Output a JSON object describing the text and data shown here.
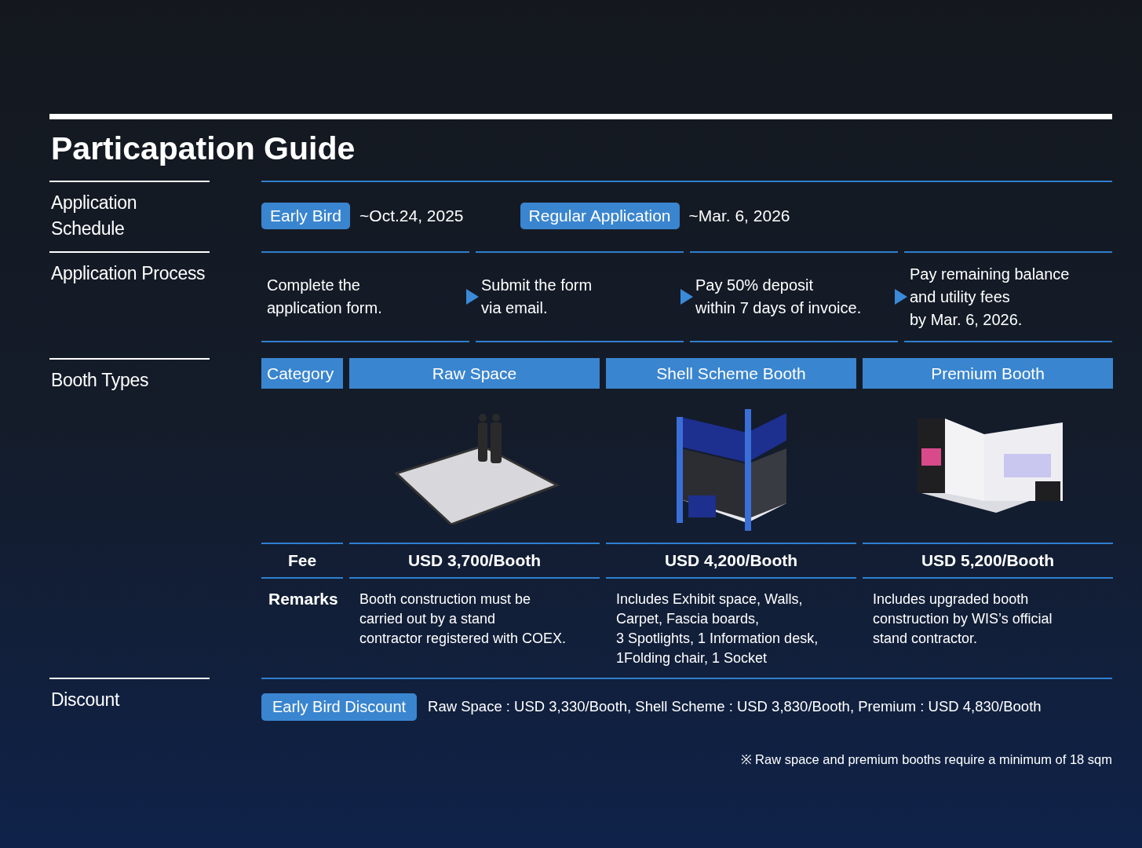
{
  "title": "Particapation Guide",
  "schedule": {
    "label": "Application Schedule",
    "items": [
      {
        "badge": "Early Bird",
        "date": "~Oct.24, 2025"
      },
      {
        "badge": "Regular Application",
        "date": "~Mar. 6, 2026"
      }
    ]
  },
  "process": {
    "label": "Application Process",
    "steps": [
      {
        "lines": [
          "Complete the",
          "application form."
        ]
      },
      {
        "lines": [
          "Submit the form",
          "via email."
        ]
      },
      {
        "lines": [
          "Pay 50% deposit",
          "within 7 days of invoice."
        ]
      },
      {
        "lines": [
          "Pay remaining balance",
          "and utility fees",
          "by Mar. 6, 2026."
        ]
      }
    ]
  },
  "booths": {
    "label": "Booth Types",
    "category": "Category",
    "types": [
      {
        "kind": "raw",
        "name": "Raw Space",
        "fee": "USD 3,700/Booth",
        "remarks": [
          "Booth construction must be",
          "carried out by a stand",
          "contractor registered with COEX."
        ]
      },
      {
        "kind": "shell",
        "name": "Shell Scheme Booth",
        "fee": "USD 4,200/Booth",
        "remarks": [
          "Includes Exhibit space, Walls,",
          "Carpet, Fascia boards,",
          "3 Spotlights, 1 Information desk,",
          "1Folding chair, 1 Socket"
        ]
      },
      {
        "kind": "premium",
        "name": "Premium Booth",
        "fee": "USD 5,200/Booth",
        "remarks": [
          "Includes upgraded booth",
          "construction by WIS’s official",
          "stand contractor."
        ]
      }
    ],
    "fee_label": "Fee",
    "remarks_label": "Remarks"
  },
  "discount": {
    "label": "Discount",
    "badge": "Early Bird Discount",
    "text": "Raw Space : USD 3,330/Booth,  Shell Scheme : USD 3,830/Booth, Premium : USD 4,830/Booth"
  },
  "note": "※ Raw space and premium booths require a minimum of 18 sqm"
}
